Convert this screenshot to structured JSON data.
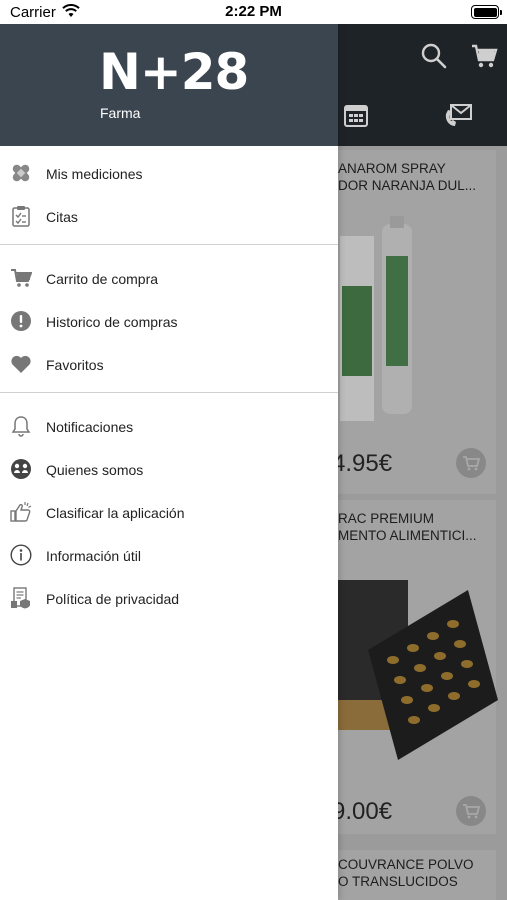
{
  "status_bar": {
    "carrier": "Carrier",
    "time": "2:22 PM"
  },
  "drawer": {
    "logo": "N+28",
    "logo_sub": "Farma",
    "sections": [
      [
        {
          "label": "Mis mediciones",
          "icon": "bandage-icon"
        },
        {
          "label": "Citas",
          "icon": "clipboard-icon"
        }
      ],
      [
        {
          "label": "Carrito de compra",
          "icon": "cart-icon"
        },
        {
          "label": "Historico de compras",
          "icon": "alert-circle-icon"
        },
        {
          "label": "Favoritos",
          "icon": "heart-icon"
        }
      ],
      [
        {
          "label": "Notificaciones",
          "icon": "bell-icon"
        },
        {
          "label": "Quienes somos",
          "icon": "about-icon"
        },
        {
          "label": "Clasificar la aplicación",
          "icon": "thumbs-up-icon"
        },
        {
          "label": "Información útil",
          "icon": "info-icon"
        },
        {
          "label": "Política de privacidad",
          "icon": "privacy-doc-icon"
        }
      ]
    ]
  },
  "background": {
    "products": [
      {
        "title_line1": "ANAROM SPRAY",
        "title_line2": "DOR NARANJA DUL...",
        "price": "4.95€"
      },
      {
        "title_line1": "RAC PREMIUM",
        "title_line2": "MENTO ALIMENTICI...",
        "price": "9.00€"
      },
      {
        "title_line1": "COUVRANCE POLVO",
        "title_line2": "O TRANSLUCIDOS",
        "price": ""
      }
    ]
  },
  "colors": {
    "drawer_header": "#3b4550",
    "app_header": "#1e2327",
    "overlay": "#9b9b9b"
  }
}
